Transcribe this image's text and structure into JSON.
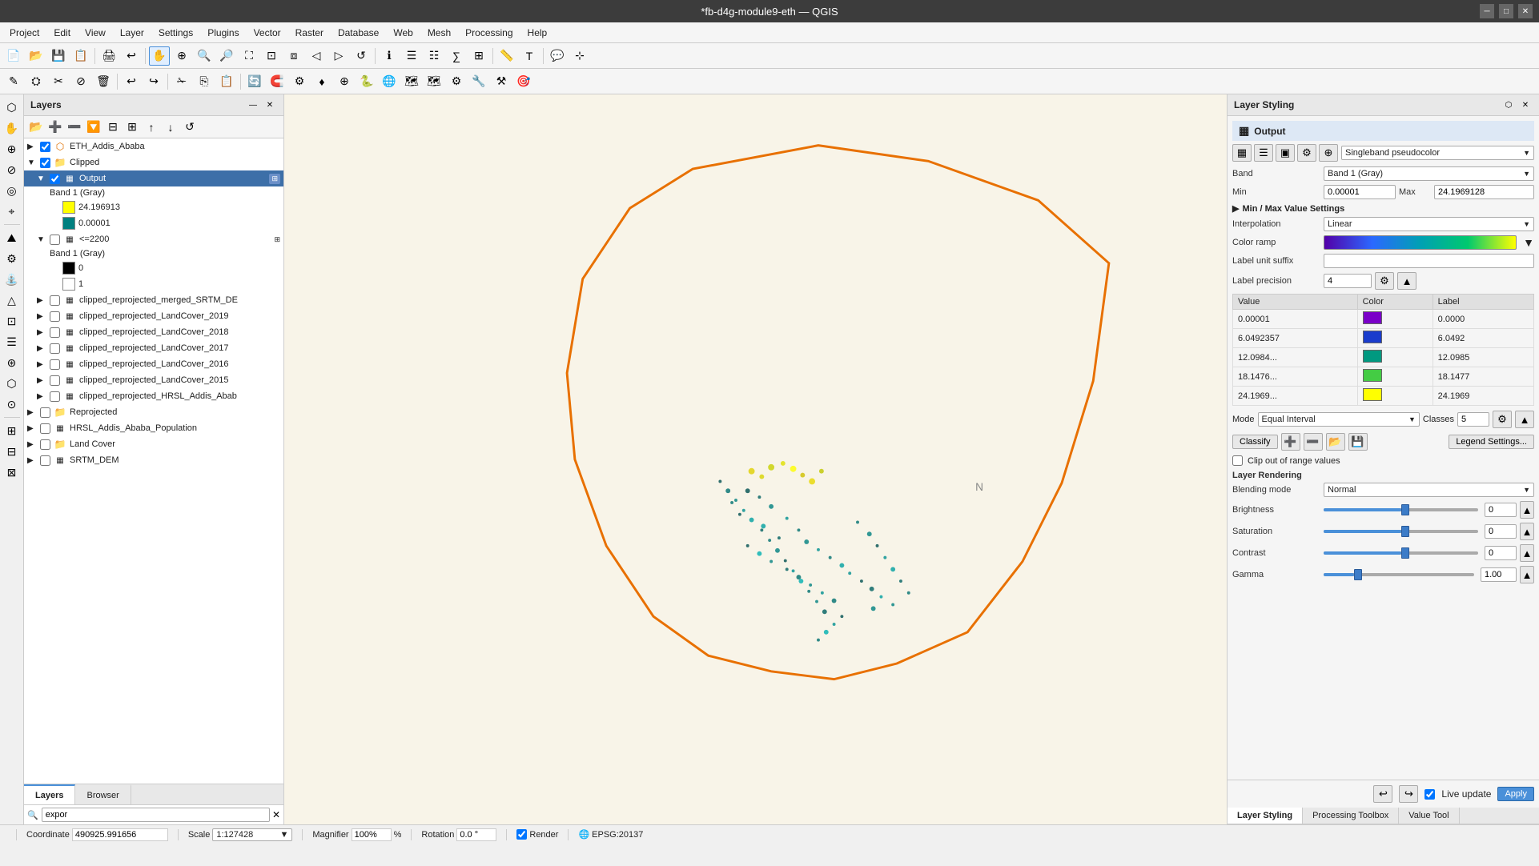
{
  "titlebar": {
    "title": "*fb-d4g-module9-eth — QGIS",
    "minimize": "─",
    "maximize": "□",
    "close": "✕"
  },
  "menubar": {
    "items": [
      "Project",
      "Edit",
      "View",
      "Layer",
      "Settings",
      "Plugins",
      "Vector",
      "Raster",
      "Database",
      "Web",
      "Mesh",
      "Processing",
      "Help"
    ]
  },
  "layers_panel": {
    "title": "Layers",
    "search_placeholder": "expor",
    "items": [
      {
        "id": "eth_addis",
        "label": "ETH_Addis_Ababa",
        "checked": true,
        "indent": 0,
        "type": "vector",
        "expanded": false
      },
      {
        "id": "clipped",
        "label": "Clipped",
        "checked": true,
        "indent": 0,
        "type": "group",
        "expanded": true
      },
      {
        "id": "output",
        "label": "Output",
        "checked": true,
        "indent": 1,
        "type": "raster",
        "expanded": true,
        "selected": true
      },
      {
        "id": "band1_gray",
        "label": "Band 1 (Gray)",
        "checked": false,
        "indent": 2,
        "type": "legend",
        "expanded": false
      },
      {
        "id": "val_24",
        "label": "24.196913",
        "indent": 3,
        "type": "color",
        "color": "#ffff00"
      },
      {
        "id": "val_0",
        "label": "0.00001",
        "indent": 3,
        "type": "color",
        "color": "#008080"
      },
      {
        "id": "clipped_reprojected_lt2200",
        "label": "<=2200",
        "checked": false,
        "indent": 1,
        "type": "raster",
        "expanded": false
      },
      {
        "id": "band1_gray2",
        "label": "Band 1 (Gray)",
        "indent": 2,
        "type": "legend_sub"
      },
      {
        "id": "val_0b",
        "label": "0",
        "indent": 3,
        "type": "color",
        "color": "#000000"
      },
      {
        "id": "val_1b",
        "label": "1",
        "indent": 3,
        "type": "color",
        "color": "#ffffff"
      },
      {
        "id": "clipped_srtm",
        "label": "clipped_reprojected_merged_SRTM_DE",
        "checked": false,
        "indent": 1,
        "type": "raster"
      },
      {
        "id": "lc2019",
        "label": "clipped_reprojected_LandCover_2019",
        "checked": false,
        "indent": 1,
        "type": "raster"
      },
      {
        "id": "lc2018",
        "label": "clipped_reprojected_LandCover_2018",
        "checked": false,
        "indent": 1,
        "type": "raster"
      },
      {
        "id": "lc2017",
        "label": "clipped_reprojected_LandCover_2017",
        "checked": false,
        "indent": 1,
        "type": "raster"
      },
      {
        "id": "lc2016",
        "label": "clipped_reprojected_LandCover_2016",
        "checked": false,
        "indent": 1,
        "type": "raster"
      },
      {
        "id": "lc2015",
        "label": "clipped_reprojected_LandCover_2015",
        "checked": false,
        "indent": 1,
        "type": "raster"
      },
      {
        "id": "hrsl_addis",
        "label": "clipped_reprojected_HRSL_Addis_Abab",
        "checked": false,
        "indent": 1,
        "type": "raster"
      },
      {
        "id": "reprojected",
        "label": "Reprojected",
        "checked": false,
        "indent": 0,
        "type": "group",
        "expanded": false
      },
      {
        "id": "hrsl_pop",
        "label": "HRSL_Addis_Ababa_Population",
        "checked": false,
        "indent": 0,
        "type": "raster"
      },
      {
        "id": "land_cover",
        "label": "Land Cover",
        "checked": false,
        "indent": 0,
        "type": "group",
        "expanded": false
      },
      {
        "id": "srtm_dem",
        "label": "SRTM_DEM",
        "checked": false,
        "indent": 0,
        "type": "raster"
      }
    ]
  },
  "layer_styling": {
    "title": "Layer Styling",
    "output_label": "Output",
    "renderer_label": "Singleband pseudocolor",
    "band_label": "Band",
    "band_value": "Band 1 (Gray)",
    "min_label": "Min",
    "min_value": "0.00001",
    "max_label": "Max",
    "max_value": "24.1969128",
    "minmax_section": "Min / Max Value Settings",
    "interpolation_label": "Interpolation",
    "interpolation_value": "Linear",
    "color_ramp_label": "Color ramp",
    "label_unit_label": "Label unit suffix",
    "label_unit_value": "",
    "label_precision_label": "Label precision",
    "label_precision_value": "4",
    "value_table": {
      "headers": [
        "Value",
        "Color",
        "Label"
      ],
      "rows": [
        {
          "value": "0.00001",
          "color": "#7a00c8",
          "label": "0.0000"
        },
        {
          "value": "6.0492357",
          "color": "#1a3ccc",
          "label": "6.0492"
        },
        {
          "value": "12.0984...",
          "color": "#009980",
          "label": "12.0985"
        },
        {
          "value": "18.1476...",
          "color": "#44cc44",
          "label": "18.1477"
        },
        {
          "value": "24.1969...",
          "color": "#ffff00",
          "label": "24.1969"
        }
      ]
    },
    "mode_label": "Mode",
    "mode_value": "Equal Interval",
    "classes_label": "Classes",
    "classes_value": "5",
    "classify_btn": "Classify",
    "legend_settings_btn": "Legend Settings...",
    "clip_label": "Clip out of range values",
    "layer_rendering_label": "Layer Rendering",
    "blending_label": "Blending mode",
    "blending_value": "Normal",
    "brightness_label": "Brightness",
    "brightness_value": "0",
    "saturation_label": "Saturation",
    "saturation_value": "0",
    "contrast_label": "Contrast",
    "contrast_value": "0",
    "gamma_label": "Gamma",
    "gamma_value": "1.00",
    "live_update_label": "Live update",
    "apply_btn": "Apply"
  },
  "bottom_tabs": {
    "tabs": [
      "Layers",
      "Browser"
    ],
    "active": "Layers"
  },
  "right_bottom_tabs": {
    "tabs": [
      "Layer Styling",
      "Processing Toolbox",
      "Value Tool"
    ],
    "active": "Layer Styling"
  },
  "statusbar": {
    "coordinate_label": "Coordinate",
    "coordinate_value": "490925.991656",
    "scale_label": "Scale",
    "scale_value": "1:127428",
    "magnifier_label": "Magnifier",
    "magnifier_value": "100%",
    "rotation_label": "Rotation",
    "rotation_value": "0.0°",
    "render_label": "Render",
    "crs_label": "EPSG:20137"
  }
}
